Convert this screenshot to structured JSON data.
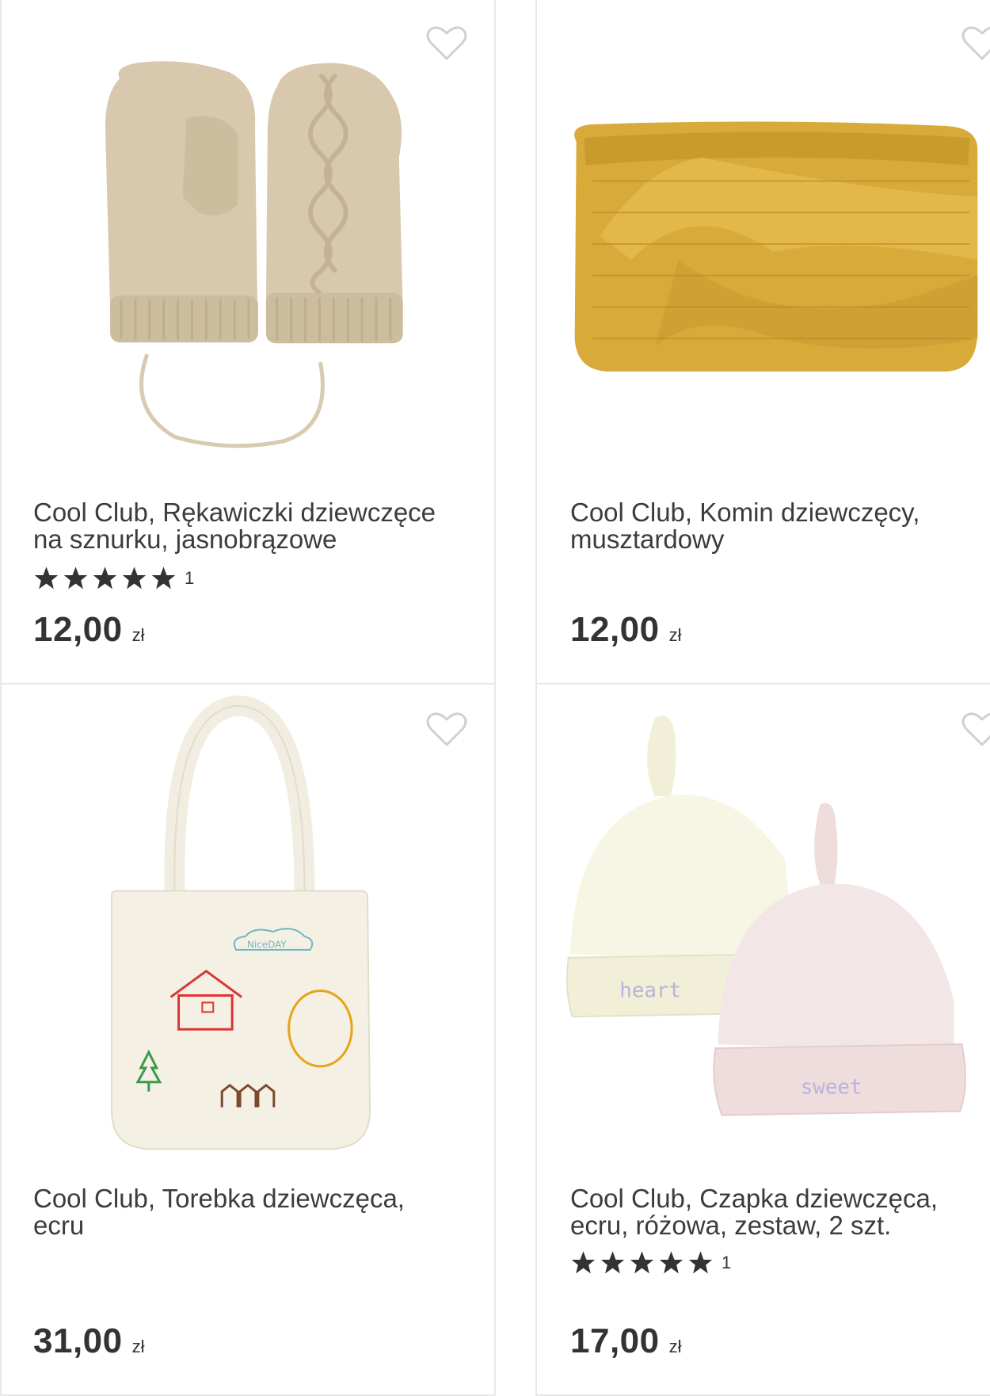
{
  "products": [
    {
      "title": "Cool Club, Rękawiczki dziewczęce na sznurku, jasnobrązowe",
      "rating_count": "1",
      "rating": 5,
      "price": "12,00",
      "currency": "zł",
      "image_icon": "mittens-image"
    },
    {
      "title": "Cool Club, Komin dziewczęcy, musztardowy",
      "price": "12,00",
      "currency": "zł",
      "image_icon": "snood-image"
    },
    {
      "title": "Cool Club, Torebka dziewczęca, ecru",
      "price": "31,00",
      "currency": "zł",
      "image_icon": "tote-bag-image",
      "image_text": "NiceDAY"
    },
    {
      "title": "Cool Club, Czapka dziewczęca, ecru, różowa, zestaw, 2 szt.",
      "rating_count": "1",
      "rating": 5,
      "price": "17,00",
      "currency": "zł",
      "image_icon": "baby-hats-image",
      "image_text_1": "heart",
      "image_text_2": "sweet"
    }
  ],
  "colors": {
    "heart_outline": "#d0d0d0",
    "star": "#333333",
    "mitten": "#d8c9ae",
    "snood": "#d8aa3a",
    "bag": "#f4f0e4",
    "hat_ecru": "#f7f5e4",
    "hat_pink": "#f3e6e6"
  }
}
